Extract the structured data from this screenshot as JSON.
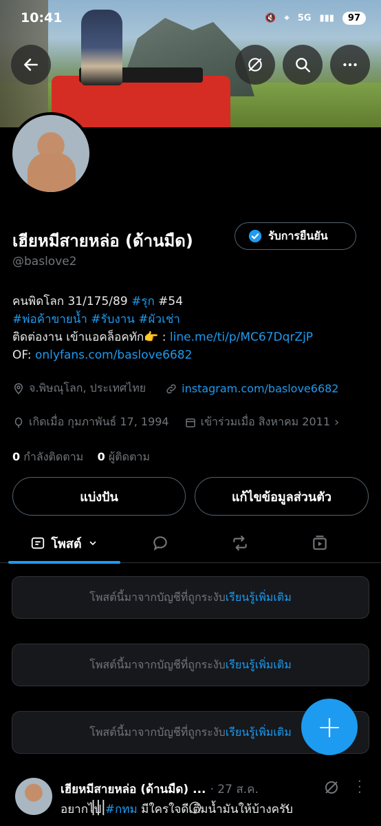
{
  "status": {
    "time": "10:41",
    "network": "5G",
    "battery": "97"
  },
  "header_buttons": {
    "back": "back-arrow-icon",
    "grok": "grok-icon",
    "search": "search-icon",
    "more": "more-icon"
  },
  "profile": {
    "display_name": "เฮียหมีสายหล่อ (ด้านมืด)",
    "verify_label": "รับการยืนยัน",
    "handle": "@baslove2",
    "bio": {
      "line1_text": "คนพิดโลก 31/175/89 ",
      "line1_tag": "#รุก",
      "line1_rest": " #54",
      "line2_tags": "#พ่อค้าขายน้ำ #รับงาน #ผัวเช่า",
      "line3_text": "ติดต่องาน เข้าแอคล็อคทัก👉 : ",
      "line3_link": "line.me/ti/p/MC67DqrZjP",
      "line4_text": "OF: ",
      "line4_link": "onlyfans.com/baslove6682"
    },
    "location": "จ.พิษณุโลก, ประเทศไทย",
    "website": "instagram.com/baslove6682",
    "birth": "เกิดเมื่อ กุมภาพันธ์ 17, 1994",
    "joined": "เข้าร่วมเมื่อ สิงหาคม 2011",
    "following_count": "0",
    "following_label": "กำลังติดตาม",
    "followers_count": "0",
    "followers_label": "ผู้ติดตาม"
  },
  "actions": {
    "share": "แบ่งปัน",
    "edit": "แก้ไขข้อมูลส่วนตัว"
  },
  "tabs": {
    "posts": "โพสต์"
  },
  "notices": [
    {
      "text": "โพสต์นี้มาจากบัญชีที่ถูกระงับ ",
      "link": "เรียนรู้เพิ่มเติม"
    },
    {
      "text": "โพสต์นี้มาจากบัญชีที่ถูกระงับ ",
      "link": "เรียนรู้เพิ่มเติม"
    },
    {
      "text": "โพสต์นี้มาจากบัญชีที่ถูกระงับ ",
      "link": "เรียนรู้เพิ่มเติม"
    }
  ],
  "fab": "+",
  "tweet": {
    "name": "เฮียหมีสายหล่อ (ด้านมืด) ...",
    "date": "· 27 ส.ค.",
    "text_before": "อยากไป ",
    "tag": "#กทม",
    "text_after": " มีใครใจดีเติมน้ำมันให้บ้างครับ"
  },
  "colors": {
    "accent": "#1d9bf0",
    "background": "#000000",
    "muted": "#71767b"
  }
}
